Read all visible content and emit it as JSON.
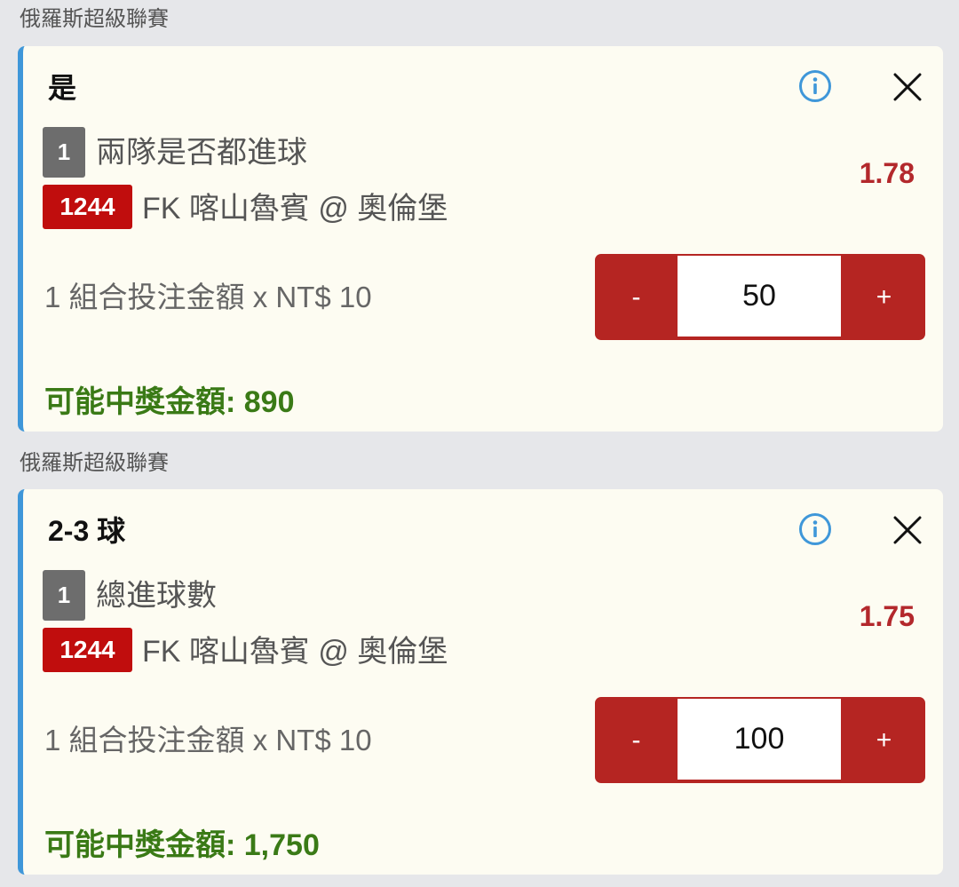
{
  "colors": {
    "background": "#e6e7ea",
    "card": "#fdfcf2",
    "accent_bar": "#3f97d9",
    "odds": "#b3282c",
    "match_badge": "#c00d0d",
    "stepper": "#b52522",
    "payout": "#3a7a16"
  },
  "bets": [
    {
      "league": "俄羅斯超級聯賽",
      "selection": "是",
      "leg_number": "1",
      "market": "兩隊是否都進球",
      "odds": "1.78",
      "match_number": "1244",
      "match_name": "FK 喀山魯賓 @ 奧倫堡",
      "stake_label": "1 組合投注金額 x NT$ 10",
      "decrement_label": "-",
      "stake_value": "50",
      "increment_label": "+",
      "payout_label": "可能中獎金額: 890",
      "info_icon": "info-icon",
      "close_icon": "close-icon"
    },
    {
      "league": "俄羅斯超級聯賽",
      "selection": "2-3 球",
      "leg_number": "1",
      "market": "總進球數",
      "odds": "1.75",
      "match_number": "1244",
      "match_name": "FK 喀山魯賓 @ 奧倫堡",
      "stake_label": "1 組合投注金額 x NT$ 10",
      "decrement_label": "-",
      "stake_value": "100",
      "increment_label": "+",
      "payout_label": "可能中獎金額: 1,750",
      "info_icon": "info-icon",
      "close_icon": "close-icon"
    }
  ]
}
